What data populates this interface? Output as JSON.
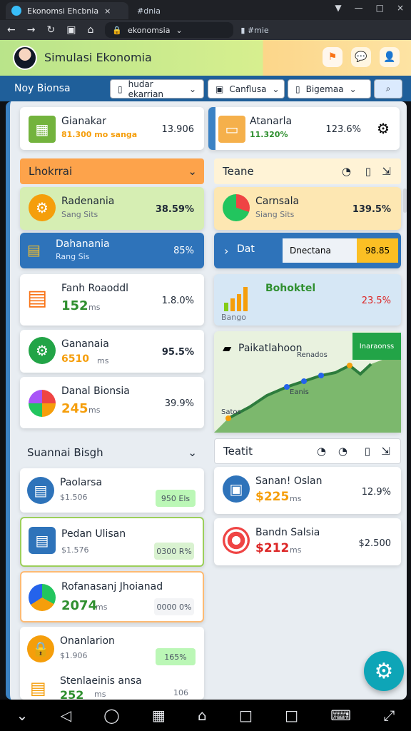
{
  "browser": {
    "tab_active": "Ekonomsi Ehcbnia",
    "tab_inactive": "#dnia",
    "url": "ekonomsia",
    "bookmark": "#mie"
  },
  "header": {
    "title": "Simulasi Ekonomia"
  },
  "toolbar": {
    "title": "Noy Bionsa",
    "button1": "hudar ekarrian",
    "button2": "Canflusa",
    "button3": "Bigemaa"
  },
  "stats": [
    {
      "title": "Gianakar",
      "sub": "81.300 mo sanga",
      "pct": "13.906"
    },
    {
      "title": "Atanarla",
      "sub": "11.320%",
      "pct": "123.6%"
    }
  ],
  "left_section": {
    "header": "Lhokrrai",
    "items": [
      {
        "title": "Radenania",
        "sub": "Sang Sits",
        "pct": "38.59%"
      },
      {
        "title": "Dahanania",
        "sub": "Rang Sis",
        "pct": "85%"
      },
      {
        "title": "Fanh Roaoddl",
        "value": "152",
        "sub": "ms",
        "pct": "1.8.0%"
      },
      {
        "title": "Gananaia",
        "value": "6510",
        "sub": "ms",
        "pct": "95.5%"
      },
      {
        "title": "Danal Bionsia",
        "value": "245",
        "sub": "ms",
        "pct": "39.9%"
      }
    ]
  },
  "right_section": {
    "header": "Teane",
    "item1": {
      "title": "Carnsala",
      "sub": "Siang Sits",
      "pct": "139.5%"
    },
    "item2": {
      "title": "Dat",
      "input": "Dnectana",
      "badge": "98.85"
    },
    "item3": {
      "title": "Bohoktel",
      "sub": "Bango",
      "pct": "23.5%"
    },
    "chart": {
      "title": "Paikatlahoon",
      "label1": "Renados",
      "label2": "Eanis",
      "label3": "Satos",
      "badge": "Inaraonss"
    }
  },
  "bottom_left": {
    "header": "Suannai Bisgh",
    "items": [
      {
        "title": "Paolarsa",
        "sub": "$1.506",
        "badge": "950 Els"
      },
      {
        "title": "Pedan Ulisan",
        "sub": "$1.576",
        "badge": "0300 R%"
      },
      {
        "title": "Rofanasanj Jhoianad",
        "value": "2074",
        "sub": "ms",
        "badge": "0000 0%"
      },
      {
        "title": "Onanlarion",
        "sub": "$1.906",
        "badge": "165%"
      },
      {
        "title": "Stenlaeinis ansa",
        "value": "252",
        "sub": "ms",
        "badge": "106"
      }
    ]
  },
  "bottom_right": {
    "header": "Teatit",
    "items": [
      {
        "title": "Sanan! Oslan",
        "value": "$225",
        "sub": "ms",
        "pct": "12.9%"
      },
      {
        "title": "Bandn Salsia",
        "value": "$212",
        "sub": "ms",
        "pct": "$2.500"
      }
    ]
  },
  "chart_data": {
    "type": "line",
    "x": [
      0,
      1,
      2,
      3,
      4,
      5,
      6,
      7
    ],
    "series": [
      {
        "values": [
          1.2,
          2.0,
          3.0,
          3.7,
          4.3,
          5.0,
          4.8,
          5.3
        ]
      }
    ],
    "title": "Paikatlahoon",
    "xlabel": "",
    "ylabel": ""
  }
}
